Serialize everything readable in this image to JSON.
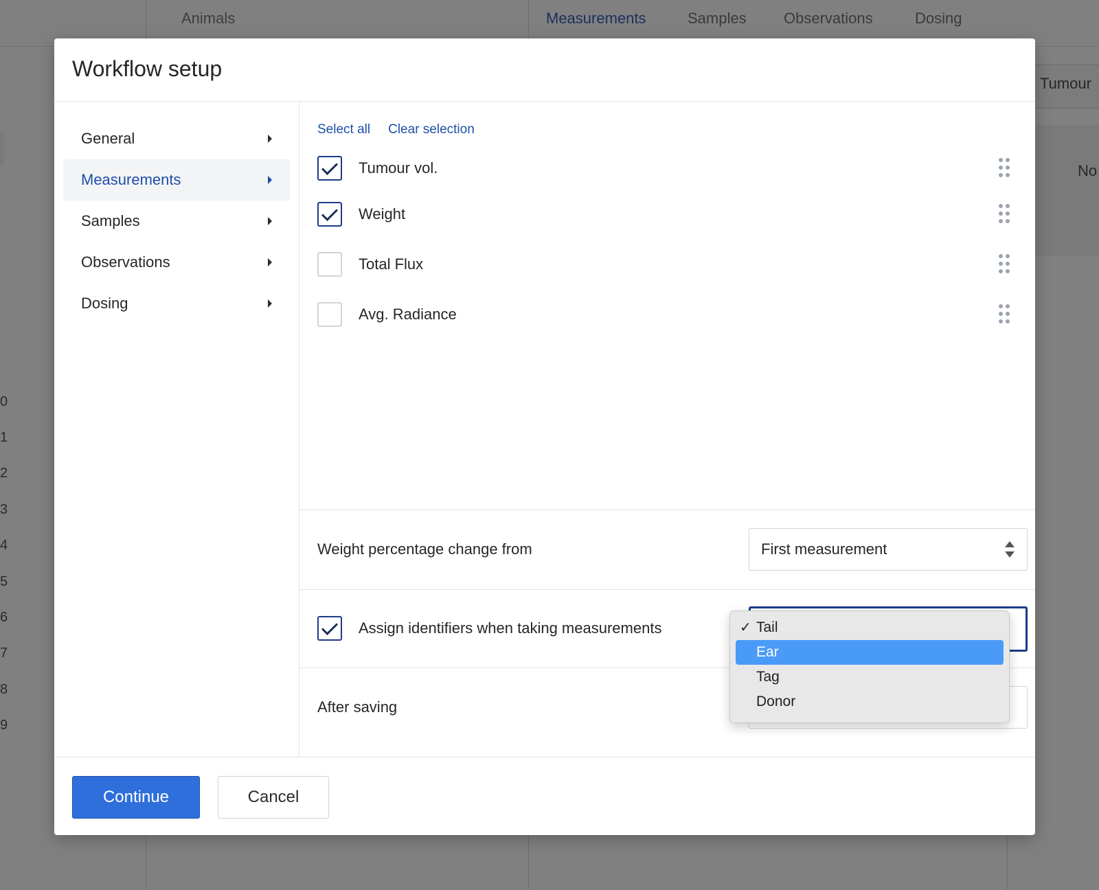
{
  "background": {
    "header_left": "Animals",
    "tabs": [
      {
        "label": "Measurements",
        "active": true
      },
      {
        "label": "Samples",
        "active": false
      },
      {
        "label": "Observations",
        "active": false
      },
      {
        "label": "Dosing",
        "active": false
      }
    ],
    "right_header": "Tumour",
    "right_cell": "No",
    "row_numbers": [
      "0",
      "1",
      "2",
      "3",
      "4",
      "5",
      "6",
      "7",
      "8",
      "9"
    ]
  },
  "modal": {
    "title": "Workflow setup",
    "sidebar": [
      {
        "label": "General",
        "active": false
      },
      {
        "label": "Measurements",
        "active": true
      },
      {
        "label": "Samples",
        "active": false
      },
      {
        "label": "Observations",
        "active": false
      },
      {
        "label": "Dosing",
        "active": false
      }
    ],
    "links": {
      "select_all": "Select all",
      "clear_selection": "Clear selection"
    },
    "measurements": [
      {
        "label": "Tumour vol.",
        "checked": true
      },
      {
        "label": "Weight",
        "checked": true
      },
      {
        "label": "Total Flux",
        "checked": false
      },
      {
        "label": "Avg. Radiance",
        "checked": false
      }
    ],
    "weight_change": {
      "label": "Weight percentage change from",
      "value": "First measurement"
    },
    "assign_identifiers": {
      "label": "Assign identifiers when taking measurements",
      "checked": true
    },
    "identifier_dropdown": {
      "options": [
        {
          "label": "Tail",
          "selected": true,
          "highlighted": false
        },
        {
          "label": "Ear",
          "selected": false,
          "highlighted": true
        },
        {
          "label": "Tag",
          "selected": false,
          "highlighted": false
        },
        {
          "label": "Donor",
          "selected": false,
          "highlighted": false
        }
      ],
      "check_glyph": "✓"
    },
    "after_saving": {
      "label": "After saving"
    },
    "footer": {
      "continue_label": "Continue",
      "cancel_label": "Cancel"
    }
  },
  "colors": {
    "accent": "#1e4fa7",
    "primary_button": "#2f6fdb",
    "highlight": "#4a9bf8"
  }
}
